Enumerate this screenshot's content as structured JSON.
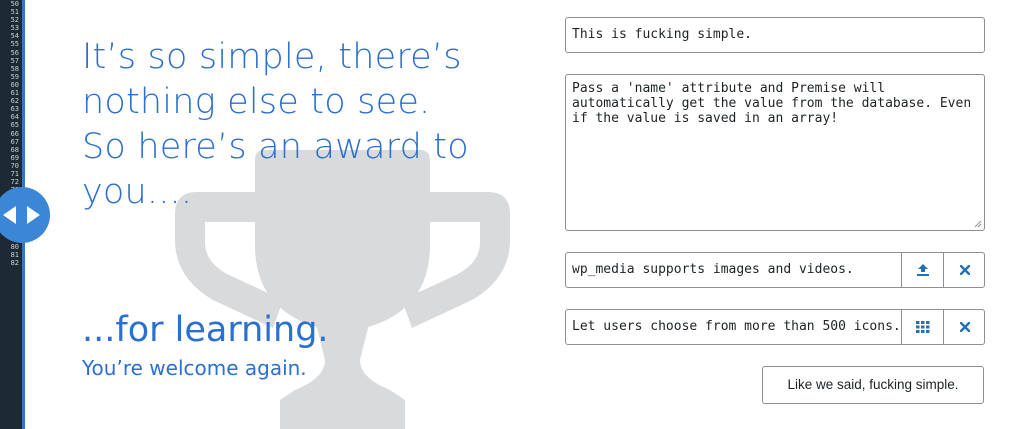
{
  "gutter": {
    "line_numbers": [
      "50",
      "51",
      "52",
      "53",
      "54",
      "55",
      "56",
      "57",
      "58",
      "59",
      "60",
      "61",
      "62",
      "63",
      "64",
      "65",
      "66",
      "67",
      "68",
      "69",
      "70",
      "71",
      "72",
      "73",
      "74",
      "75",
      "76",
      "77",
      "78",
      "79",
      "80",
      "81",
      "82"
    ]
  },
  "hero": {
    "lines": [
      "It’s so simple, there’s",
      "nothing else to see.",
      "So here’s an award to",
      "you...."
    ],
    "learning": "...for learning.",
    "welcome": "You’re welcome again."
  },
  "form": {
    "text_field_value": "This is fucking simple.",
    "textarea_value": "Pass a 'name' attribute and Premise will automatically get the value from the database. Even if the value is saved in an array!",
    "media_field_value": "wp_media supports images and videos.",
    "icon_field_value": "Let users choose from more than 500 icons.",
    "submit_label": "Like we said, fucking simple."
  },
  "icons": {
    "toggle": "left-right-arrows-icon",
    "trophy": "trophy-icon",
    "upload": "upload-icon",
    "grid": "grid-icon",
    "remove": "close-icon",
    "resize": "resize-handle-icon"
  },
  "colors": {
    "accent": "#2b6fcf",
    "toggle": "#3c86d6",
    "gutter": "#1d2a35",
    "trophy": "#d9dadc",
    "button_icon": "#2271b1"
  }
}
